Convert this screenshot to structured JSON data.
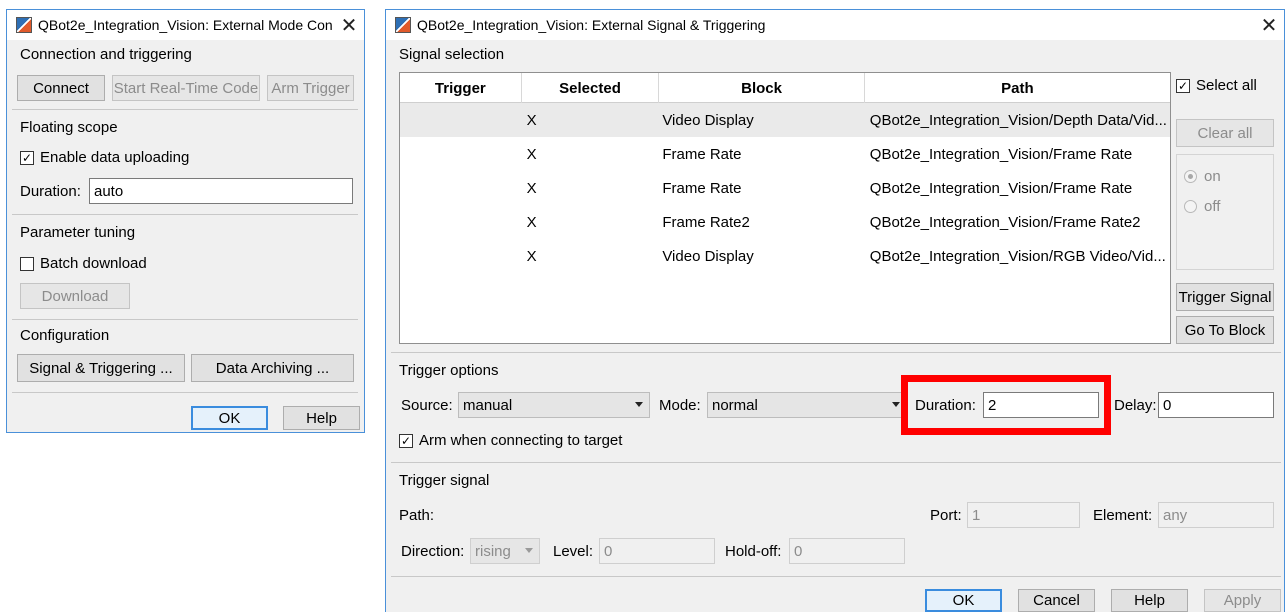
{
  "external_mode_window": {
    "title": "QBot2e_Integration_Vision: External Mode Con...",
    "sections": {
      "connection": {
        "label": "Connection and triggering",
        "connect": "Connect",
        "start_rt": "Start Real-Time Code",
        "arm_trigger": "Arm Trigger"
      },
      "floating_scope": {
        "label": "Floating scope",
        "enable_upload": "Enable data uploading",
        "enable_upload_checked": true,
        "duration_label": "Duration:",
        "duration_value": "auto"
      },
      "parameter_tuning": {
        "label": "Parameter tuning",
        "batch_download": "Batch download",
        "batch_download_checked": false,
        "download": "Download"
      },
      "configuration": {
        "label": "Configuration",
        "signal_triggering": "Signal & Triggering ...",
        "data_archiving": "Data Archiving ..."
      }
    },
    "ok": "OK",
    "help": "Help"
  },
  "signal_trigger_window": {
    "title": "QBot2e_Integration_Vision: External Signal & Triggering",
    "signal_selection": {
      "label": "Signal selection",
      "columns": [
        "Trigger",
        "Selected",
        "Block",
        "Path"
      ],
      "rows": [
        {
          "trigger": "",
          "selected": "X",
          "block": "Video Display",
          "path": "QBot2e_Integration_Vision/Depth Data/Vid..."
        },
        {
          "trigger": "",
          "selected": "X",
          "block": "Frame Rate",
          "path": "QBot2e_Integration_Vision/Frame Rate"
        },
        {
          "trigger": "",
          "selected": "X",
          "block": "Frame Rate",
          "path": "QBot2e_Integration_Vision/Frame Rate"
        },
        {
          "trigger": "",
          "selected": "X",
          "block": "Frame Rate2",
          "path": "QBot2e_Integration_Vision/Frame Rate2"
        },
        {
          "trigger": "",
          "selected": "X",
          "block": "Video Display",
          "path": "QBot2e_Integration_Vision/RGB Video/Vid..."
        }
      ],
      "select_all": "Select all",
      "select_all_checked": true,
      "clear_all": "Clear all",
      "radio_on": "on",
      "radio_off": "off",
      "trigger_signal": "Trigger Signal",
      "go_to_block": "Go To Block"
    },
    "trigger_options": {
      "label": "Trigger options",
      "source_label": "Source:",
      "source_value": "manual",
      "mode_label": "Mode:",
      "mode_value": "normal",
      "duration_label": "Duration:",
      "duration_value": "2",
      "delay_label": "Delay:",
      "delay_value": "0",
      "arm_connect": "Arm when connecting to target",
      "arm_connect_checked": true
    },
    "trigger_signal": {
      "label": "Trigger signal",
      "path_label": "Path:",
      "port_label": "Port:",
      "port_value": "1",
      "element_label": "Element:",
      "element_value": "any",
      "direction_label": "Direction:",
      "direction_value": "rising",
      "level_label": "Level:",
      "level_value": "0",
      "holdoff_label": "Hold-off:",
      "holdoff_value": "0"
    },
    "ok": "OK",
    "cancel": "Cancel",
    "help": "Help",
    "apply": "Apply"
  },
  "colors": {
    "highlight": "#ff0000",
    "window_border": "#4a90d9",
    "default_button_border": "#3a8cde"
  }
}
